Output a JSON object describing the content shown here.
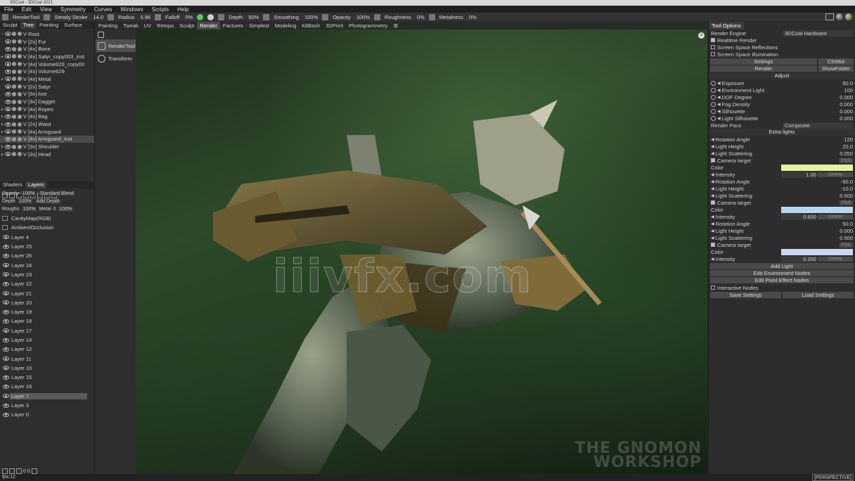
{
  "window": {
    "title": "3DCoat - 3DCoat 2021"
  },
  "menu": [
    "File",
    "Edit",
    "View",
    "Symmetry",
    "Curves",
    "Windows",
    "Scripts",
    "Help"
  ],
  "toolbar": {
    "tool": "RenderTool",
    "steady_stroke_label": "Steady Stroke",
    "steady_stroke_value": "14.0",
    "radius_label": "Radius",
    "radius_value": "5.96",
    "falloff_label": "Falloff",
    "falloff_value": "0%",
    "depth_label": "Depth",
    "depth_value": "50%",
    "smoothing_label": "Smoothing",
    "smoothing_value": "100%",
    "opacity_label": "Opacity",
    "opacity_value": "100%",
    "roughness_label": "Roughness",
    "roughness_value": "0%",
    "metalness_label": "Metalness",
    "metalness_value": "0%"
  },
  "left_tabs": [
    "Sculpt",
    "Tree",
    "Painting",
    "Surface"
  ],
  "tree": [
    {
      "expand": "-",
      "label": "V  Root"
    },
    {
      "expand": "",
      "label": "V  [2x]  Fur"
    },
    {
      "expand": "",
      "label": "V  [4x]  Bone"
    },
    {
      "expand": "+",
      "label": "V  [4x]  Satyr_copy003_inst"
    },
    {
      "expand": "",
      "label": "V  [4x]  Volume629_copy00"
    },
    {
      "expand": "",
      "label": "V  [4x]  Volume629"
    },
    {
      "expand": "+",
      "label": "V  [4x]  Metal"
    },
    {
      "expand": "",
      "label": "V  [2x]  Satyr"
    },
    {
      "expand": "",
      "label": "V  [3x]  Axe"
    },
    {
      "expand": "",
      "label": "V  [3x]  Dagger"
    },
    {
      "expand": "+",
      "label": "V  [4x]  Ropes"
    },
    {
      "expand": "+",
      "label": "V  [4x]  Bag"
    },
    {
      "expand": "+",
      "label": "V  [2x]  Waist"
    },
    {
      "expand": "+",
      "label": "V  [4x]  Armguard"
    },
    {
      "expand": "",
      "label": "V  [4x]  Armguard_inst",
      "selected": true
    },
    {
      "expand": "+",
      "label": "V  [3x]  Shoulder"
    },
    {
      "expand": "+",
      "label": "V  [3x]  Head"
    }
  ],
  "layers_tabs": [
    "Shaders",
    "Layers"
  ],
  "blend": {
    "opacity_label": "Opacity",
    "opacity_value": "100%",
    "blend_mode": "Standard Blend",
    "depth_label": "Depth",
    "depth_value": "100%",
    "depth_mode": "Add Depth",
    "rough_label": "Roughn",
    "rough_value": "100%",
    "metal_label": "Metal",
    "metal_o": "0",
    "metal_value": "100%"
  },
  "layers": [
    {
      "name": "CavityMap(RGB)",
      "locked": true
    },
    {
      "name": "AmbientOcclusion",
      "locked": true
    },
    {
      "name": "Layer 4"
    },
    {
      "name": "Layer 25"
    },
    {
      "name": "Layer 26"
    },
    {
      "name": "Layer 24"
    },
    {
      "name": "Layer 23"
    },
    {
      "name": "Layer 22"
    },
    {
      "name": "Layer 21"
    },
    {
      "name": "Layer 20"
    },
    {
      "name": "Layer 19"
    },
    {
      "name": "Layer 18"
    },
    {
      "name": "Layer 17"
    },
    {
      "name": "Layer 14"
    },
    {
      "name": "Layer 12"
    },
    {
      "name": "Layer 11"
    },
    {
      "name": "Layer 10"
    },
    {
      "name": "Layer 15"
    },
    {
      "name": "Layer 16"
    },
    {
      "name": "Layer 7",
      "selected": true
    },
    {
      "name": "Layer 3"
    },
    {
      "name": "Layer 0"
    }
  ],
  "layers_footer_count": "0  0",
  "rooms": [
    "Painting",
    "Tweak",
    "UV",
    "Retopo",
    "Sculpt",
    "Render",
    "Factures",
    "Simplest",
    "Modeling",
    "KitBash",
    "3DPrint",
    "Photogrammetry"
  ],
  "active_room": "Render",
  "tools": [
    {
      "label": "RenderTool",
      "active": true
    },
    {
      "label": "Transform",
      "active": false
    }
  ],
  "viewport": {
    "watermark": "iiivfx.com",
    "brand_line1": "THE GNOMON",
    "brand_line2": "WORKSHOP"
  },
  "status": {
    "fps": "fps:12",
    "projection": "[PERSPECTIVE]"
  },
  "tool_options": {
    "tab": "Tool Options",
    "render_engine_label": "Render Engine",
    "render_engine_value": "3DCoat Hardware",
    "realtime_render": "Realtime Render",
    "ssr": "Screen Space Reflections",
    "ssi": "Screen Space Illumination",
    "settings_btn": "Settings",
    "settings_value": "C5I96d",
    "render_btn": "Render",
    "show_folder_btn": "ShowFolder",
    "adjust_header": "Adjust",
    "adjust": [
      {
        "label": "Exposure",
        "value": "50.0"
      },
      {
        "label": "Environment Light",
        "value": "100"
      },
      {
        "label": "DOF Degree",
        "value": "0.000"
      },
      {
        "label": "Fog Density",
        "value": "0.000"
      },
      {
        "label": "Silhouette",
        "value": "0.000"
      },
      {
        "label": "Light Silhouette",
        "value": "0.000"
      }
    ],
    "render_pass_label": "Render Pass",
    "render_pass_value": "Composite",
    "extra_lights_header": "Extra lights",
    "lights": [
      {
        "rotation": "120",
        "height": "20.0",
        "scattering": "0.050",
        "intensity": "1.00",
        "color": "#e9f0a0"
      },
      {
        "rotation": "-60.0",
        "height": "-10.0",
        "scattering": "0.500",
        "intensity": "0.600",
        "color": "#b5d7f2"
      },
      {
        "rotation": "50.0",
        "height": "0.000",
        "scattering": "0.500",
        "intensity": "0.200",
        "color": "#c9d8f2"
      }
    ],
    "rotation_label": "Rotation Angle",
    "height_label": "Light Height",
    "scattering_label": "Light Scattering",
    "camera_target_label": "Camera target",
    "color_label": "Color",
    "intensity_label": "Intensity",
    "pick_label": "Pick",
    "delete_label": "Delete",
    "add_light": "Add Light",
    "edit_env_nodes": "Edit Environment Nodes",
    "edit_point_nodes": "Edit Point Effect Nodes",
    "interactive_nodes": "Interactive Nodes",
    "save_settings": "Save Settings",
    "load_settings": "Load Settings"
  }
}
